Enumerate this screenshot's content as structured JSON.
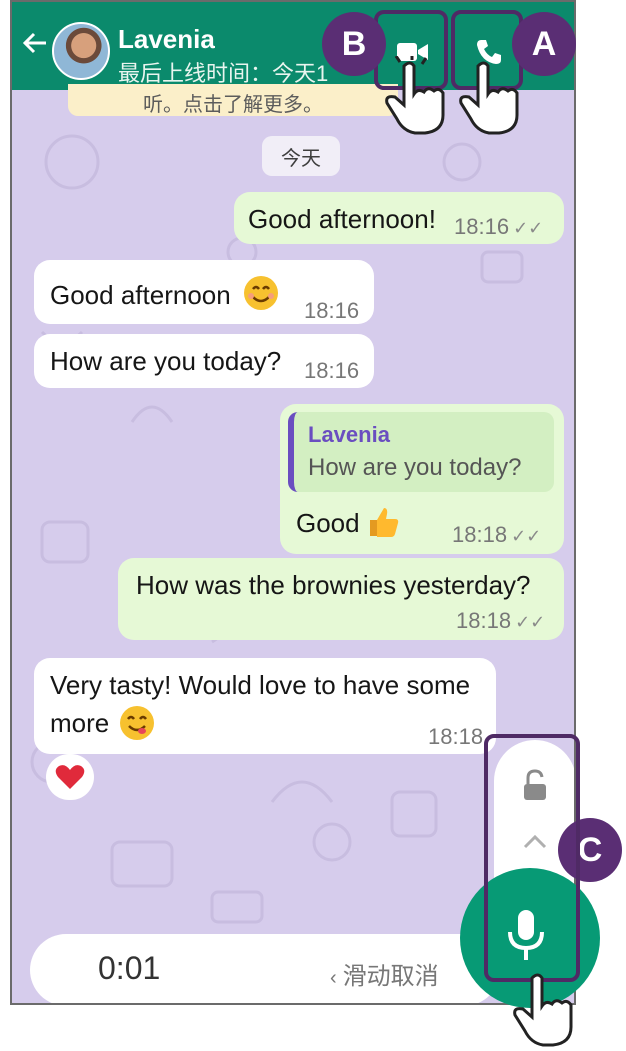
{
  "header": {
    "contact_name": "Lavenia",
    "status": "最后上线时间：今天1"
  },
  "banner": {
    "encryption_note": "听。点击了解更多。"
  },
  "date_chip": "今天",
  "messages": [
    {
      "dir": "out",
      "text": "Good afternoon!",
      "time": "18:16",
      "ticks": "✓✓"
    },
    {
      "dir": "in",
      "text": "Good afternoon",
      "emoji": "smiling-face-icon",
      "time": "18:16"
    },
    {
      "dir": "in",
      "text": "How are you today?",
      "time": "18:16"
    },
    {
      "dir": "out",
      "reply_to_name": "Lavenia",
      "reply_to_text": "How are you today?",
      "text": "Good",
      "emoji": "thumbs-up-icon",
      "time": "18:18",
      "ticks": "✓✓"
    },
    {
      "dir": "out",
      "text": "How was the brownies yesterday?",
      "time": "18:18",
      "ticks": "✓✓"
    },
    {
      "dir": "in",
      "text_line1": "Very tasty! Would love to have some",
      "text_line2": "more",
      "emoji": "yum-face-icon",
      "time": "18:18",
      "reaction": "heart-icon"
    }
  ],
  "recording": {
    "timer": "0:01",
    "cancel_hint": "滑动取消"
  },
  "annotations": {
    "a": "A",
    "b": "B",
    "c": "C"
  },
  "colors": {
    "header": "#0b8a6c",
    "wallpaper": "#d6ccec",
    "outgoing_bubble": "#e6f9d6",
    "incoming_bubble": "#ffffff",
    "accent_purple": "#5a2e74",
    "mic_green": "#079a75"
  }
}
